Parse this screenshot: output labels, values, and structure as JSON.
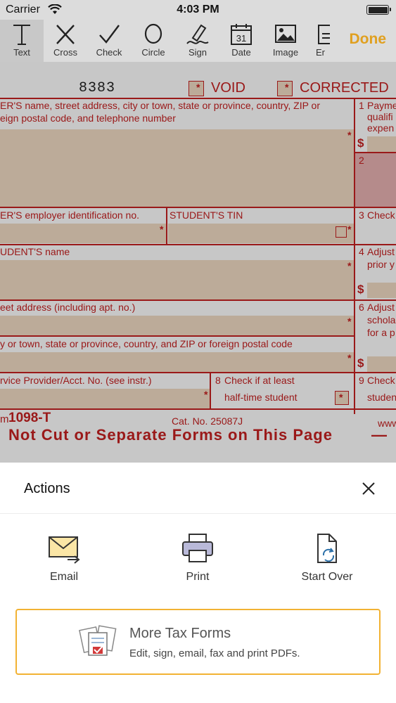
{
  "status_bar": {
    "carrier": "Carrier",
    "time": "4:03 PM"
  },
  "toolbar": {
    "tools": [
      {
        "label": "Text",
        "icon": "text-icon"
      },
      {
        "label": "Cross",
        "icon": "cross-icon"
      },
      {
        "label": "Check",
        "icon": "check-icon"
      },
      {
        "label": "Circle",
        "icon": "circle-icon"
      },
      {
        "label": "Sign",
        "icon": "sign-icon"
      },
      {
        "label": "Date",
        "icon": "calendar-icon"
      },
      {
        "label": "Image",
        "icon": "image-icon"
      },
      {
        "label": "Er",
        "icon": "eraser-icon"
      }
    ],
    "date_icon_day": "31",
    "done_label": "Done"
  },
  "form": {
    "code": "8383",
    "void_label": "VOID",
    "corrected_label": "CORRECTED",
    "filer_label_line1": "ER'S name, street address, city or town, state or province, country, ZIP or",
    "filer_label_line2": "eign postal code, and telephone number",
    "box1_line1": "Payme",
    "box1_line2": "qualifi",
    "box1_line3": "expen",
    "box1_num": "1",
    "box2_num": "2",
    "dollar": "$",
    "ein_label": "ER'S employer identification no.",
    "tin_label": "STUDENT'S TIN",
    "box3_label": "Check",
    "box3_num": "3",
    "student_name_label": "UDENT'S name",
    "box4_num": "4",
    "box4_line1": "Adjust",
    "box4_line2": "prior y",
    "street_label": "eet address (including apt. no.)",
    "box6_num": "6",
    "box6_line1": "Adjust",
    "box6_line2": "schola",
    "box6_line3": "for a p",
    "city_label": "y or town, state or province, country, and ZIP or foreign postal code",
    "service_label": "rvice Provider/Acct. No. (see instr.)",
    "box8_num": "8",
    "box8_line1": "Check if at least",
    "box8_line2": "half-time student",
    "box9_num": "9",
    "box9_line1": "Check",
    "box9_line2": "studen",
    "form_name_prefix": "m",
    "form_name": "1098-T",
    "cat_no": "Cat. No. 25087J",
    "www": "www",
    "banner": "Not Cut or Separate Forms on This Page",
    "banner_dash": "—",
    "star": "*"
  },
  "actions_sheet": {
    "title": "Actions",
    "items": [
      {
        "label": "Email",
        "icon": "email-icon"
      },
      {
        "label": "Print",
        "icon": "printer-icon"
      },
      {
        "label": "Start Over",
        "icon": "start-over-icon"
      }
    ],
    "promo": {
      "title": "More Tax Forms",
      "subtitle": "Edit, sign, email, fax and print PDFs.",
      "icon": "tax-forms-icon"
    }
  },
  "colors": {
    "accent": "#e0a020",
    "form_red": "#c62020",
    "field_fill": "#f1dcc4",
    "promo_border": "#f2b233"
  }
}
